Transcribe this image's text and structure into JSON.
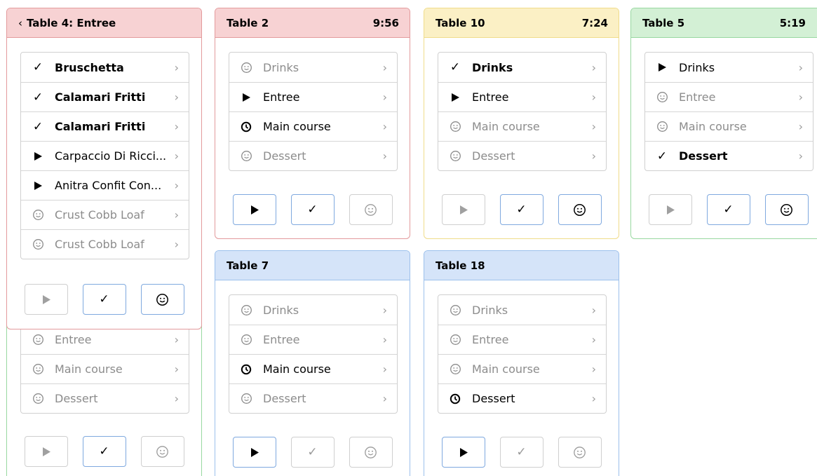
{
  "icons": {
    "done": "check-icon",
    "progress": "play-icon",
    "waiting": "clock-icon",
    "pending": "smiley-icon"
  },
  "common": {
    "check": "✓",
    "arrow": "›"
  },
  "colors": {
    "red": "#f7d2d3",
    "yellow": "#fbf0c5",
    "green": "#d3f0d5",
    "blue": "#d5e4f9",
    "active_border": "#7fa9df"
  },
  "cards": [
    {
      "id": "table-4",
      "title": "Table 4: Entree",
      "back": "‹",
      "time": "",
      "items": [
        {
          "label": "Bruschetta",
          "status": "done"
        },
        {
          "label": "Calamari Fritti",
          "status": "done"
        },
        {
          "label": "Calamari Fritti",
          "status": "done"
        },
        {
          "label": "Carpaccio Di Ricci...",
          "status": "progress"
        },
        {
          "label": "Anitra Confit Con...",
          "status": "progress"
        },
        {
          "label": "Crust Cobb Loaf",
          "status": "pending"
        },
        {
          "label": "Crust Cobb Loaf",
          "status": "pending"
        }
      ],
      "buttons": {
        "play": false,
        "check": true,
        "smile": true
      }
    },
    {
      "id": "table-2",
      "title": "Table 2",
      "time": "9:56",
      "items": [
        {
          "label": "Drinks",
          "status": "pending"
        },
        {
          "label": "Entree",
          "status": "progress"
        },
        {
          "label": "Main course",
          "status": "waiting"
        },
        {
          "label": "Dessert",
          "status": "pending"
        }
      ],
      "buttons": {
        "play": true,
        "check": true,
        "smile": false
      }
    },
    {
      "id": "table-10",
      "title": "Table 10",
      "time": "7:24",
      "items": [
        {
          "label": "Drinks",
          "status": "done"
        },
        {
          "label": "Entree",
          "status": "progress"
        },
        {
          "label": "Main course",
          "status": "pending"
        },
        {
          "label": "Dessert",
          "status": "pending"
        }
      ],
      "buttons": {
        "play": false,
        "check": true,
        "smile": true
      }
    },
    {
      "id": "table-5",
      "title": "Table 5",
      "time": "5:19",
      "items": [
        {
          "label": "Drinks",
          "status": "progress"
        },
        {
          "label": "Entree",
          "status": "pending"
        },
        {
          "label": "Main course",
          "status": "pending"
        },
        {
          "label": "Dessert",
          "status": "done"
        }
      ],
      "buttons": {
        "play": false,
        "check": true,
        "smile": true
      }
    },
    {
      "id": "table-7",
      "title": "Table 7",
      "time": "",
      "items": [
        {
          "label": "Drinks",
          "status": "pending"
        },
        {
          "label": "Entree",
          "status": "pending"
        },
        {
          "label": "Main course",
          "status": "waiting"
        },
        {
          "label": "Dessert",
          "status": "pending"
        }
      ],
      "buttons": {
        "play": true,
        "check": false,
        "smile": false
      }
    },
    {
      "id": "table-18",
      "title": "Table 18",
      "time": "",
      "items": [
        {
          "label": "Drinks",
          "status": "pending"
        },
        {
          "label": "Entree",
          "status": "pending"
        },
        {
          "label": "Main course",
          "status": "pending"
        },
        {
          "label": "Dessert",
          "status": "waiting"
        }
      ],
      "buttons": {
        "play": true,
        "check": false,
        "smile": false
      }
    },
    {
      "id": "hidden-card",
      "title": "",
      "time": "",
      "items": [
        {
          "label": "Entree",
          "status": "pending"
        },
        {
          "label": "Main course",
          "status": "pending"
        },
        {
          "label": "Dessert",
          "status": "pending"
        }
      ],
      "buttons": {
        "play": false,
        "check": true,
        "smile": false
      }
    }
  ]
}
